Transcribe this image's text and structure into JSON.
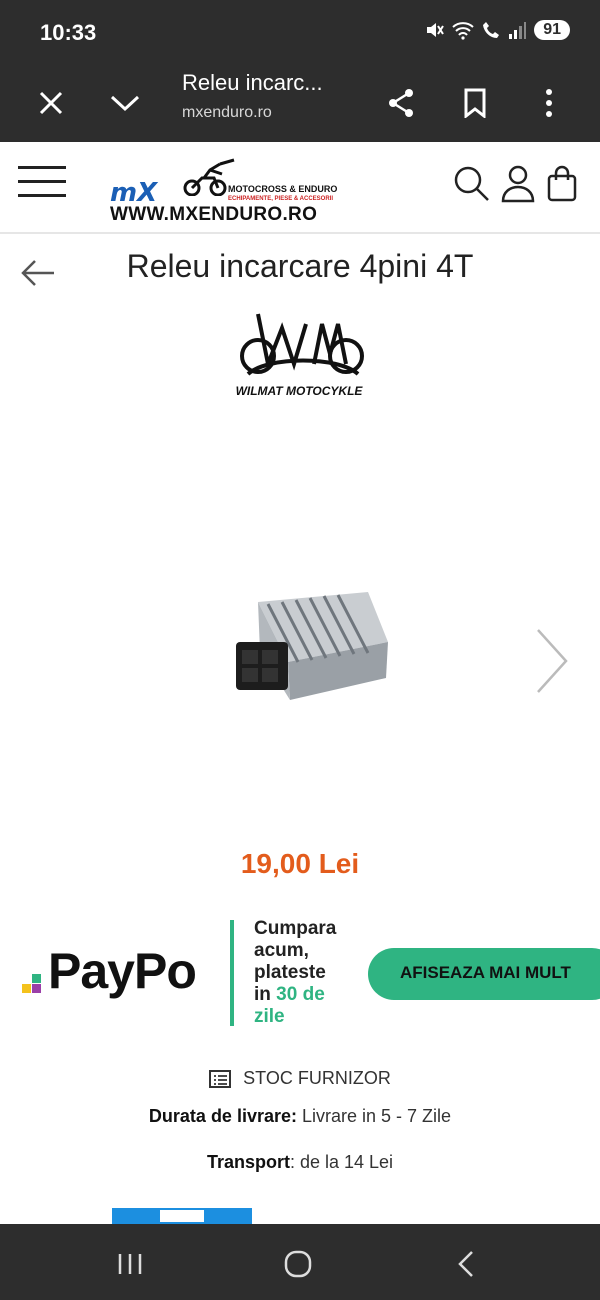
{
  "status": {
    "time": "10:33",
    "battery": "91"
  },
  "browser": {
    "title": "Releu incarc...",
    "url": "mxenduro.ro"
  },
  "site": {
    "logo_mx": "mX",
    "logo_tag1": "MOTOCROSS & ENDURO",
    "logo_tag2": "ECHIPAMENTE, PIESE & ACCESORII",
    "logo_www": "WWW.MXENDURO.RO"
  },
  "product": {
    "title": "Releu incarcare 4pini 4T",
    "brand": "WILMAT MOTOCYKLE",
    "price": "19,00 Lei"
  },
  "paypo": {
    "brand": "PayPo",
    "line1": "Cumpara",
    "line2": "acum,",
    "line3": "plateste",
    "line4_prefix": "in",
    "line4_highlight": "30 de",
    "line5_highlight": "zile",
    "button": "AFISEAZA MAI MULT"
  },
  "info": {
    "stock": "STOC FURNIZOR",
    "delivery_label": "Durata de livrare:",
    "delivery_value": "Livrare in 5 - 7 Zile",
    "transport_label": "Transport",
    "transport_value": ": de la 14 Lei"
  },
  "colors": {
    "accent_green": "#2fb482",
    "price_orange": "#e35c1c",
    "bar": "#2d2d2d"
  }
}
